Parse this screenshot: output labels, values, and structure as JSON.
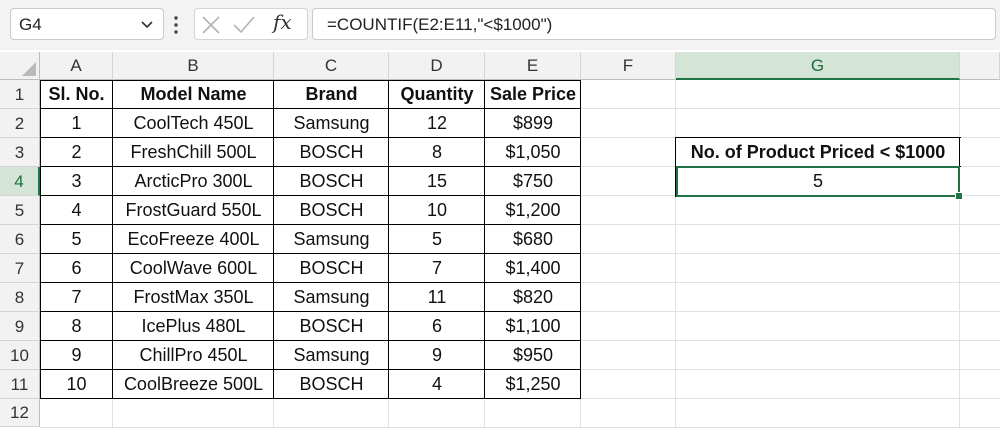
{
  "formula_bar": {
    "name_box": "G4",
    "fx_label": "fx",
    "formula": "=COUNTIF(E2:E11,\"<$1000\")"
  },
  "columns": [
    "A",
    "B",
    "C",
    "D",
    "E",
    "F",
    "G"
  ],
  "rows": [
    "1",
    "2",
    "3",
    "4",
    "5",
    "6",
    "7",
    "8",
    "9",
    "10",
    "11",
    "12"
  ],
  "table": {
    "headers": [
      "Sl. No.",
      "Model Name",
      "Brand",
      "Quantity",
      "Sale Price"
    ],
    "rows": [
      [
        "1",
        "CoolTech 450L",
        "Samsung",
        "12",
        "$899"
      ],
      [
        "2",
        "FreshChill 500L",
        "BOSCH",
        "8",
        "$1,050"
      ],
      [
        "3",
        "ArcticPro 300L",
        "BOSCH",
        "15",
        "$750"
      ],
      [
        "4",
        "FrostGuard 550L",
        "BOSCH",
        "10",
        "$1,200"
      ],
      [
        "5",
        "EcoFreeze 400L",
        "Samsung",
        "5",
        "$680"
      ],
      [
        "6",
        "CoolWave 600L",
        "BOSCH",
        "7",
        "$1,400"
      ],
      [
        "7",
        "FrostMax 350L",
        "Samsung",
        "11",
        "$820"
      ],
      [
        "8",
        "IcePlus 480L",
        "BOSCH",
        "6",
        "$1,100"
      ],
      [
        "9",
        "ChillPro 450L",
        "Samsung",
        "9",
        "$950"
      ],
      [
        "10",
        "CoolBreeze 500L",
        "BOSCH",
        "4",
        "$1,250"
      ]
    ]
  },
  "result": {
    "label": "No. of Product Priced < $1000",
    "value": "5"
  },
  "selection": {
    "active_cell": "G4",
    "active_column": "G",
    "active_row": "4"
  },
  "colors": {
    "accent": "#217346",
    "header_bg": "#f2f2f2",
    "selected_header_bg": "#d4e4d6",
    "gridline": "#e1e1e1"
  }
}
